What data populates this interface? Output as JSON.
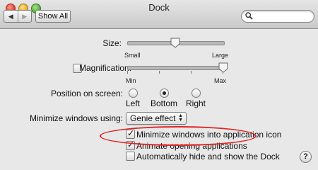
{
  "window": {
    "title": "Dock"
  },
  "toolbar": {
    "back_glyph": "◀",
    "forward_glyph": "▶",
    "show_all_label": "Show All",
    "search": {
      "value": "",
      "placeholder": ""
    }
  },
  "size": {
    "label": "Size:",
    "min_label": "Small",
    "max_label": "Large",
    "value": 0.5
  },
  "magnification": {
    "label": "Magnification:",
    "checked": false,
    "min_label": "Min",
    "max_label": "Max",
    "value": 1.0
  },
  "position": {
    "label": "Position on screen:",
    "options": [
      {
        "label": "Left",
        "selected": false
      },
      {
        "label": "Bottom",
        "selected": true
      },
      {
        "label": "Right",
        "selected": false
      }
    ]
  },
  "minimize": {
    "label": "Minimize windows using:",
    "selected": "Genie effect"
  },
  "checkboxes": [
    {
      "label": "Minimize windows into application icon",
      "checked": true
    },
    {
      "label": "Animate opening applications",
      "checked": true
    },
    {
      "label": "Automatically hide and show the Dock",
      "checked": false
    }
  ],
  "help": {
    "glyph": "?"
  },
  "colors": {
    "annotation": "#e02424"
  }
}
